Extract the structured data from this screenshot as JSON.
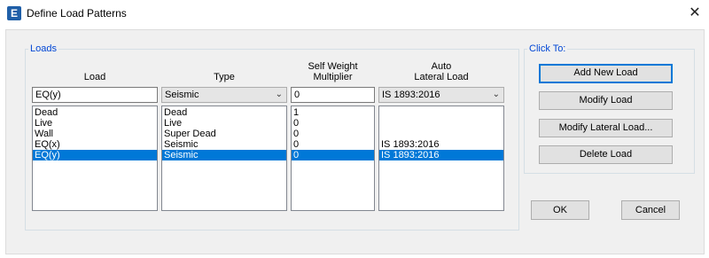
{
  "window": {
    "title": "Define Load Patterns",
    "app_icon_letter": "E",
    "close_glyph": "✕"
  },
  "loads_group": {
    "label": "Loads",
    "headers": {
      "load": "Load",
      "type": "Type",
      "self_weight_line1": "Self Weight",
      "self_weight_line2": "Multiplier",
      "auto_lateral_line1": "Auto",
      "auto_lateral_line2": "Lateral Load"
    },
    "inputs": {
      "load_name": "EQ(y)",
      "type": "Seismic",
      "multiplier": "0",
      "auto_lateral": "IS 1893:2016"
    },
    "rows": [
      {
        "load": "Dead",
        "type": "Dead",
        "multiplier": "1",
        "auto_lateral": ""
      },
      {
        "load": "Live",
        "type": "Live",
        "multiplier": "0",
        "auto_lateral": ""
      },
      {
        "load": "Wall",
        "type": "Super Dead",
        "multiplier": "0",
        "auto_lateral": ""
      },
      {
        "load": "EQ(x)",
        "type": "Seismic",
        "multiplier": "0",
        "auto_lateral": "IS 1893:2016"
      },
      {
        "load": "EQ(y)",
        "type": "Seismic",
        "multiplier": "0",
        "auto_lateral": "IS 1893:2016"
      }
    ],
    "selected_row": 4
  },
  "clickto_group": {
    "label": "Click To:",
    "buttons": {
      "add_new": "Add New Load",
      "modify": "Modify Load",
      "modify_lateral": "Modify Lateral Load...",
      "delete": "Delete Load"
    }
  },
  "dialog_buttons": {
    "ok": "OK",
    "cancel": "Cancel"
  },
  "colors": {
    "selection": "#0078d7",
    "group_label": "#0046d5",
    "default_button_border": "#0078d7"
  }
}
